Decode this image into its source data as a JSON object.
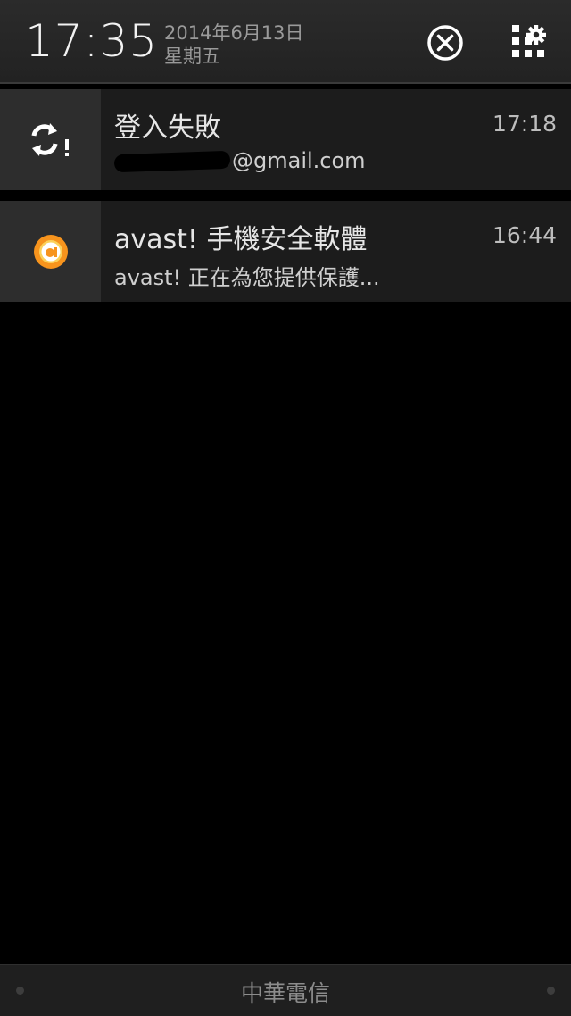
{
  "header": {
    "time": "17:35",
    "date": "2014年6月13日",
    "weekday": "星期五",
    "clear_icon": "clear-all-icon",
    "settings_icon": "quick-settings-icon"
  },
  "notifications": [
    {
      "title": "登入失敗",
      "time": "17:18",
      "subtitle_suffix": "@gmail.com",
      "icon": "sync-error-icon"
    },
    {
      "title": "avast! 手機安全軟體",
      "time": "16:44",
      "subtitle": "avast! 正在為您提供保護...",
      "icon": "avast-icon",
      "icon_color": "#f7941d"
    }
  ],
  "footer": {
    "carrier": "中華電信"
  }
}
